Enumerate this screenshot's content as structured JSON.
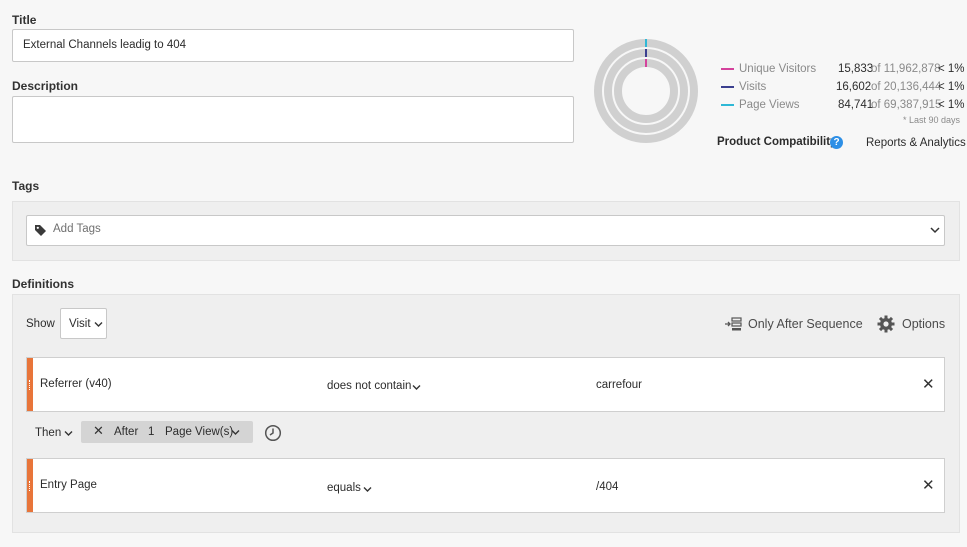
{
  "form": {
    "title_label": "Title",
    "title_value": "External Channels leadig to 404",
    "description_label": "Description",
    "description_value": "",
    "tags_label": "Tags",
    "tags_placeholder": "Add Tags",
    "definitions_label": "Definitions"
  },
  "summary": {
    "rows": [
      {
        "label": "Unique Visitors",
        "count": "15,833",
        "of": "of 11,962,878",
        "pct": "< 1%",
        "color": "#d4429c"
      },
      {
        "label": "Visits",
        "count": "16,602",
        "of": "of 20,136,444",
        "pct": "< 1%",
        "color": "#3b3f8f"
      },
      {
        "label": "Page Views",
        "count": "84,741",
        "of": "of 69,387,915",
        "pct": "< 1%",
        "color": "#2fb8d6"
      }
    ],
    "note": "* Last 90 days",
    "compat_label": "Product Compatibility",
    "compat_value": "Reports & Analytics"
  },
  "definitions": {
    "show_label": "Show",
    "container": "Visit",
    "sequence_label": "Only After Sequence",
    "options_label": "Options",
    "rules": [
      {
        "field": "Referrer (v40)",
        "operator": "does not contain",
        "value": "carrefour"
      },
      {
        "field": "Entry Page",
        "operator": "equals",
        "value": "/404"
      }
    ],
    "then_label": "Then",
    "after_label": "After",
    "after_count": "1",
    "after_unit": "Page View(s)"
  }
}
